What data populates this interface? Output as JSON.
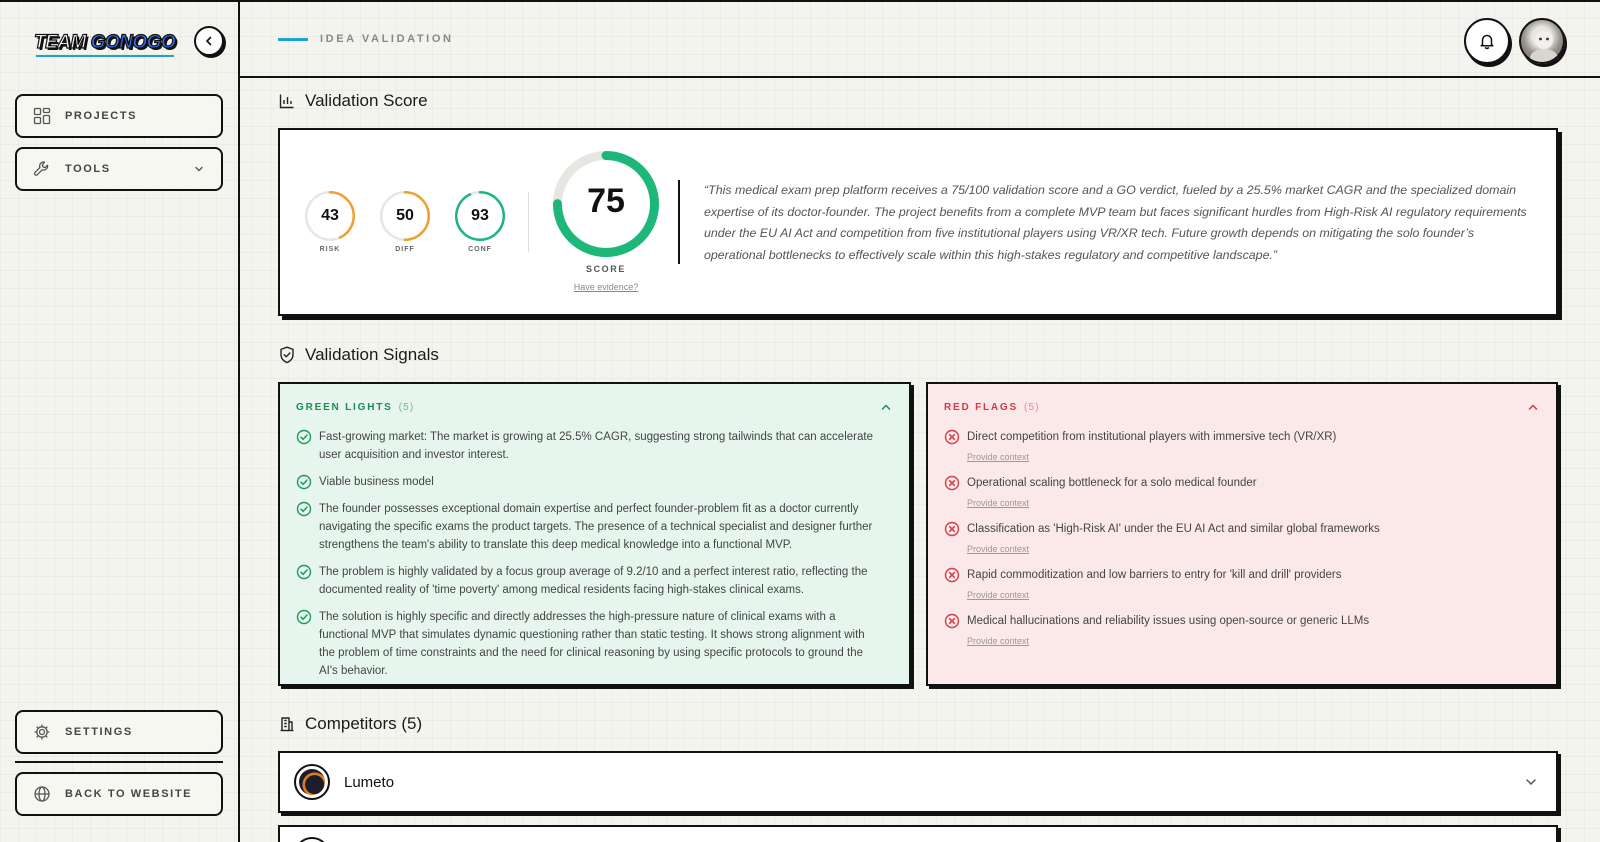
{
  "sidebar": {
    "logo_part1": "TEAM ",
    "logo_part2": "GONOGO",
    "nav": {
      "projects": "PROJECTS",
      "tools": "TOOLS",
      "settings": "SETTINGS",
      "back": "BACK TO WEBSITE"
    }
  },
  "header": {
    "breadcrumb": "IDEA VALIDATION"
  },
  "score_section": {
    "title": "Validation Score",
    "risk": {
      "value": "43",
      "label": "RISK",
      "fraction": 0.43,
      "color": "#f0a030"
    },
    "diff": {
      "value": "50",
      "label": "DIFF",
      "fraction": 0.5,
      "color": "#f0a030"
    },
    "conf": {
      "value": "93",
      "label": "CONF",
      "fraction": 0.93,
      "color": "#1db77a"
    },
    "score": {
      "value": "75",
      "label": "SCORE",
      "fraction": 0.75,
      "color": "#1db77a"
    },
    "evidence_link": "Have evidence?",
    "summary": "“This medical exam prep platform receives a 75/100 validation score and a GO verdict, fueled by a 25.5% market CAGR and the specialized domain expertise of its doctor-founder. The project benefits from a complete MVP team but faces significant hurdles from High-Risk AI regulatory requirements under the EU AI Act and competition from five institutional players using VR/XR tech. Future growth depends on mitigating the solo founder’s operational bottlenecks to effectively scale within this high-stakes regulatory and competitive landscape.”"
  },
  "signals": {
    "title": "Validation Signals",
    "green": {
      "label": "GREEN LIGHTS",
      "count": "(5)",
      "items": [
        "Fast-growing market: The market is growing at 25.5% CAGR, suggesting strong tailwinds that can accelerate user acquisition and investor interest.",
        "Viable business model",
        "The founder possesses exceptional domain expertise and perfect founder-problem fit as a doctor currently navigating the specific exams the product targets. The presence of a technical specialist and designer further strengthens the team's ability to translate this deep medical knowledge into a functional MVP.",
        "The problem is highly validated by a focus group average of 9.2/10 and a perfect interest ratio, reflecting the documented reality of 'time poverty' among medical residents facing high-stakes clinical exams.",
        "The solution is highly specific and directly addresses the high-pressure nature of clinical exams with a functional MVP that simulates dynamic questioning rather than static testing. It shows strong alignment with the problem of time constraints and the need for clinical reasoning by using specific protocols to ground the AI's behavior."
      ]
    },
    "red": {
      "label": "RED FLAGS",
      "count": "(5)",
      "provide_label": "Provide context",
      "items": [
        "Direct competition from institutional players with immersive tech (VR/XR)",
        "Operational scaling bottleneck for a solo medical founder",
        "Classification as 'High-Risk AI' under the EU AI Act and similar global frameworks",
        "Rapid commoditization and low barriers to entry for 'kill and drill' providers",
        "Medical hallucinations and reliability issues using open-source or generic LLMs"
      ]
    }
  },
  "competitors": {
    "title": "Competitors (5)",
    "items": [
      {
        "name": "Lumeto"
      }
    ]
  },
  "icons": {
    "bell": "bell-icon",
    "collapse": "chevron-left-icon",
    "projects": "grid-icon",
    "tools": "wrench-icon",
    "settings": "gear-icon",
    "back": "globe-icon",
    "score": "bar-chart-icon",
    "signals": "shield-check-icon",
    "competitors": "building-icon"
  }
}
